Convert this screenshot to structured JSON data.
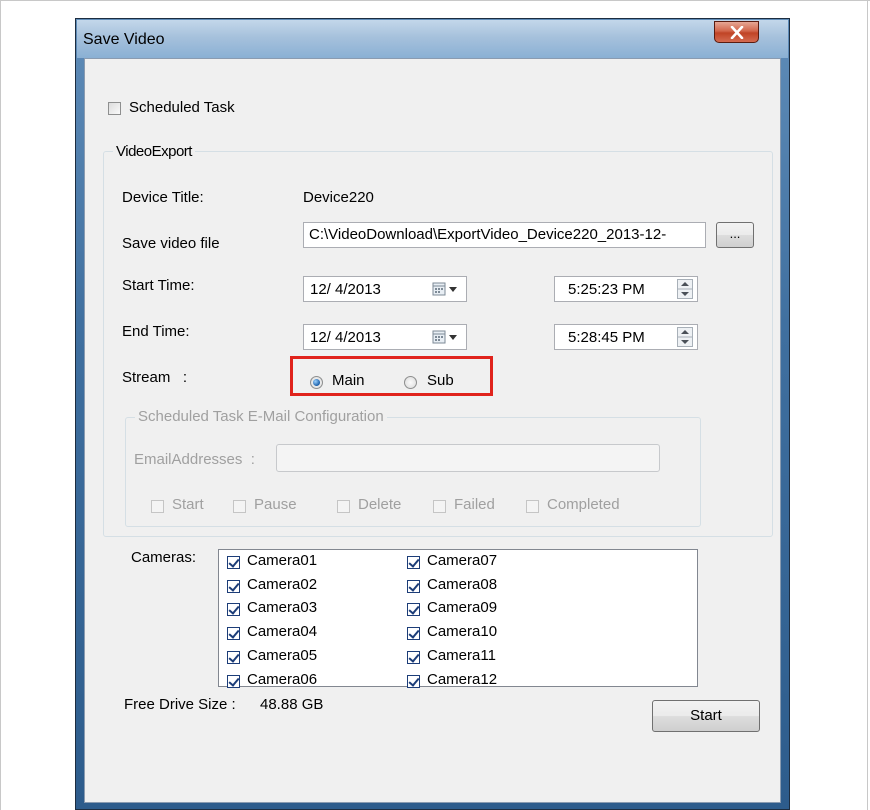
{
  "window": {
    "title": "Save Video",
    "close_glyph": "x"
  },
  "scheduled_task": {
    "label": "Scheduled Task",
    "checked": false
  },
  "video_export": {
    "group_title": "VideoExport",
    "device_title_label": "Device Title:",
    "device_title_value": "Device220",
    "save_file_label": "Save video file",
    "save_file_value": "C:\\VideoDownload\\ExportVideo_Device220_2013-12-",
    "browse_label": "...",
    "start_time_label": "Start Time:",
    "start_date": "12/ 4/2013",
    "start_time": "5:25:23 PM",
    "end_time_label": "End Time:",
    "end_date": "12/ 4/2013",
    "end_time": "5:28:45 PM",
    "stream_label": "Stream   :",
    "stream_options": [
      {
        "label": "Main",
        "selected": true
      },
      {
        "label": "Sub",
        "selected": false
      }
    ]
  },
  "email_config": {
    "group_title": "Scheduled Task E-Mail Configuration",
    "email_label": "EmailAddresses  :",
    "email_value": "",
    "options": [
      "Start",
      "Pause",
      "Delete",
      "Failed",
      "Completed"
    ]
  },
  "cameras": {
    "label": "Cameras:",
    "column1": [
      "Camera01",
      "Camera02",
      "Camera03",
      "Camera04",
      "Camera05",
      "Camera06"
    ],
    "column2": [
      "Camera07",
      "Camera08",
      "Camera09",
      "Camera10",
      "Camera11",
      "Camera12"
    ]
  },
  "free_drive": {
    "label": "Free Drive Size :",
    "value": "48.88 GB"
  },
  "start_button": "Start",
  "colors": {
    "highlight_border": "#e0231c",
    "close_button": "#c04425",
    "titlebar": "#a6c1dc"
  }
}
